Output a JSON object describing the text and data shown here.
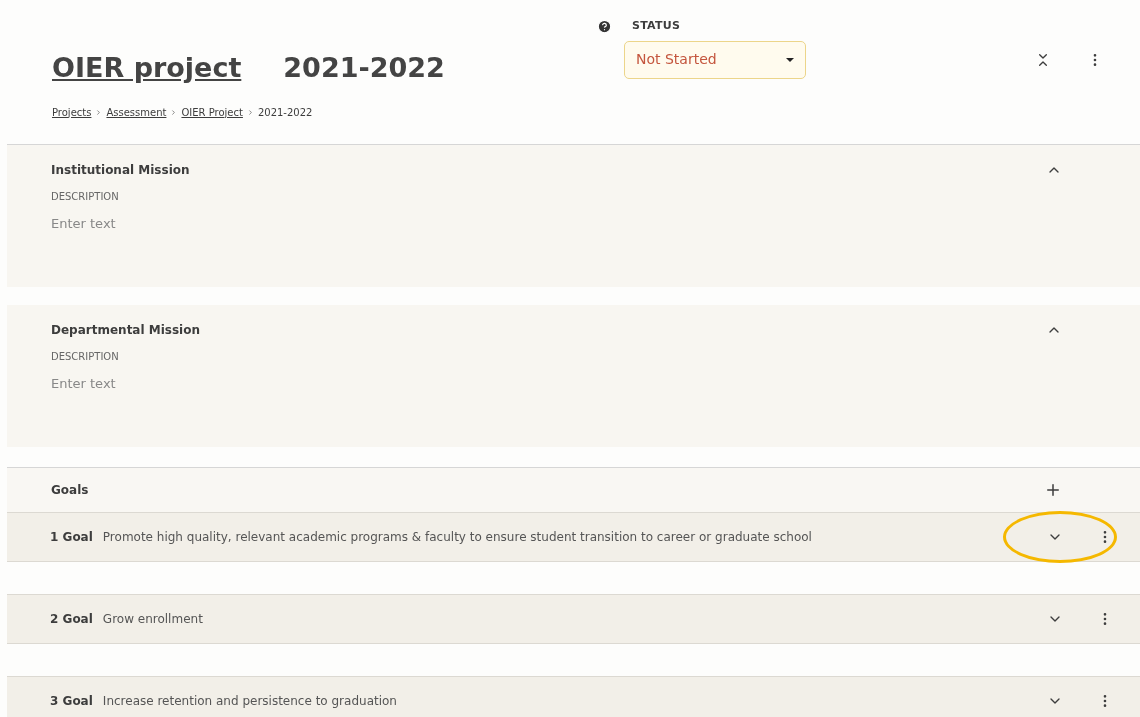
{
  "header": {
    "title": "OIER project",
    "year": "2021-2022",
    "status_label": "STATUS",
    "status_value": "Not Started"
  },
  "breadcrumb": [
    "Projects",
    "Assessment",
    "OIER Project",
    "2021-2022"
  ],
  "sections": [
    {
      "title": "Institutional Mission",
      "expanded": true,
      "field_label": "DESCRIPTION",
      "placeholder": "Enter text"
    },
    {
      "title": "Departmental Mission",
      "expanded": true,
      "field_label": "DESCRIPTION",
      "placeholder": "Enter text"
    }
  ],
  "goals_header": {
    "title": "Goals"
  },
  "goals": [
    {
      "number": "1 Goal",
      "text": "Promote high quality, relevant academic programs & faculty to ensure student transition to career or graduate school",
      "expanded": false,
      "highlighted": true
    },
    {
      "number": "2 Goal",
      "text": "Grow enrollment",
      "expanded": false,
      "highlighted": false
    },
    {
      "number": "3 Goal",
      "text": "Increase retention and persistence to graduation",
      "expanded": false,
      "highlighted": false
    }
  ]
}
